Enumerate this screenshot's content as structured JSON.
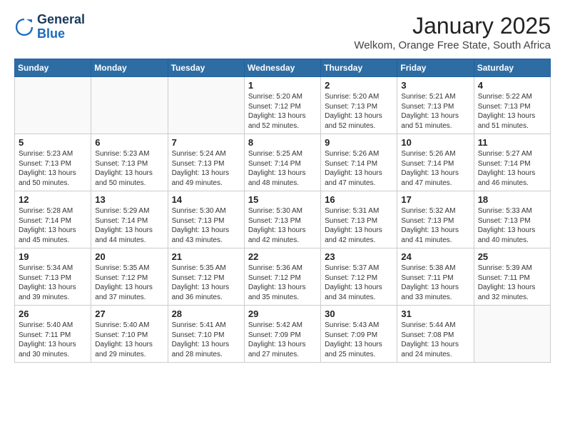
{
  "logo": {
    "line1": "General",
    "line2": "Blue"
  },
  "title": "January 2025",
  "subtitle": "Welkom, Orange Free State, South Africa",
  "weekdays": [
    "Sunday",
    "Monday",
    "Tuesday",
    "Wednesday",
    "Thursday",
    "Friday",
    "Saturday"
  ],
  "weeks": [
    [
      {
        "day": "",
        "info": ""
      },
      {
        "day": "",
        "info": ""
      },
      {
        "day": "",
        "info": ""
      },
      {
        "day": "1",
        "info": "Sunrise: 5:20 AM\nSunset: 7:12 PM\nDaylight: 13 hours and 52 minutes."
      },
      {
        "day": "2",
        "info": "Sunrise: 5:20 AM\nSunset: 7:13 PM\nDaylight: 13 hours and 52 minutes."
      },
      {
        "day": "3",
        "info": "Sunrise: 5:21 AM\nSunset: 7:13 PM\nDaylight: 13 hours and 51 minutes."
      },
      {
        "day": "4",
        "info": "Sunrise: 5:22 AM\nSunset: 7:13 PM\nDaylight: 13 hours and 51 minutes."
      }
    ],
    [
      {
        "day": "5",
        "info": "Sunrise: 5:23 AM\nSunset: 7:13 PM\nDaylight: 13 hours and 50 minutes."
      },
      {
        "day": "6",
        "info": "Sunrise: 5:23 AM\nSunset: 7:13 PM\nDaylight: 13 hours and 50 minutes."
      },
      {
        "day": "7",
        "info": "Sunrise: 5:24 AM\nSunset: 7:13 PM\nDaylight: 13 hours and 49 minutes."
      },
      {
        "day": "8",
        "info": "Sunrise: 5:25 AM\nSunset: 7:14 PM\nDaylight: 13 hours and 48 minutes."
      },
      {
        "day": "9",
        "info": "Sunrise: 5:26 AM\nSunset: 7:14 PM\nDaylight: 13 hours and 47 minutes."
      },
      {
        "day": "10",
        "info": "Sunrise: 5:26 AM\nSunset: 7:14 PM\nDaylight: 13 hours and 47 minutes."
      },
      {
        "day": "11",
        "info": "Sunrise: 5:27 AM\nSunset: 7:14 PM\nDaylight: 13 hours and 46 minutes."
      }
    ],
    [
      {
        "day": "12",
        "info": "Sunrise: 5:28 AM\nSunset: 7:14 PM\nDaylight: 13 hours and 45 minutes."
      },
      {
        "day": "13",
        "info": "Sunrise: 5:29 AM\nSunset: 7:14 PM\nDaylight: 13 hours and 44 minutes."
      },
      {
        "day": "14",
        "info": "Sunrise: 5:30 AM\nSunset: 7:13 PM\nDaylight: 13 hours and 43 minutes."
      },
      {
        "day": "15",
        "info": "Sunrise: 5:30 AM\nSunset: 7:13 PM\nDaylight: 13 hours and 42 minutes."
      },
      {
        "day": "16",
        "info": "Sunrise: 5:31 AM\nSunset: 7:13 PM\nDaylight: 13 hours and 42 minutes."
      },
      {
        "day": "17",
        "info": "Sunrise: 5:32 AM\nSunset: 7:13 PM\nDaylight: 13 hours and 41 minutes."
      },
      {
        "day": "18",
        "info": "Sunrise: 5:33 AM\nSunset: 7:13 PM\nDaylight: 13 hours and 40 minutes."
      }
    ],
    [
      {
        "day": "19",
        "info": "Sunrise: 5:34 AM\nSunset: 7:13 PM\nDaylight: 13 hours and 39 minutes."
      },
      {
        "day": "20",
        "info": "Sunrise: 5:35 AM\nSunset: 7:12 PM\nDaylight: 13 hours and 37 minutes."
      },
      {
        "day": "21",
        "info": "Sunrise: 5:35 AM\nSunset: 7:12 PM\nDaylight: 13 hours and 36 minutes."
      },
      {
        "day": "22",
        "info": "Sunrise: 5:36 AM\nSunset: 7:12 PM\nDaylight: 13 hours and 35 minutes."
      },
      {
        "day": "23",
        "info": "Sunrise: 5:37 AM\nSunset: 7:12 PM\nDaylight: 13 hours and 34 minutes."
      },
      {
        "day": "24",
        "info": "Sunrise: 5:38 AM\nSunset: 7:11 PM\nDaylight: 13 hours and 33 minutes."
      },
      {
        "day": "25",
        "info": "Sunrise: 5:39 AM\nSunset: 7:11 PM\nDaylight: 13 hours and 32 minutes."
      }
    ],
    [
      {
        "day": "26",
        "info": "Sunrise: 5:40 AM\nSunset: 7:11 PM\nDaylight: 13 hours and 30 minutes."
      },
      {
        "day": "27",
        "info": "Sunrise: 5:40 AM\nSunset: 7:10 PM\nDaylight: 13 hours and 29 minutes."
      },
      {
        "day": "28",
        "info": "Sunrise: 5:41 AM\nSunset: 7:10 PM\nDaylight: 13 hours and 28 minutes."
      },
      {
        "day": "29",
        "info": "Sunrise: 5:42 AM\nSunset: 7:09 PM\nDaylight: 13 hours and 27 minutes."
      },
      {
        "day": "30",
        "info": "Sunrise: 5:43 AM\nSunset: 7:09 PM\nDaylight: 13 hours and 25 minutes."
      },
      {
        "day": "31",
        "info": "Sunrise: 5:44 AM\nSunset: 7:08 PM\nDaylight: 13 hours and 24 minutes."
      },
      {
        "day": "",
        "info": ""
      }
    ]
  ]
}
